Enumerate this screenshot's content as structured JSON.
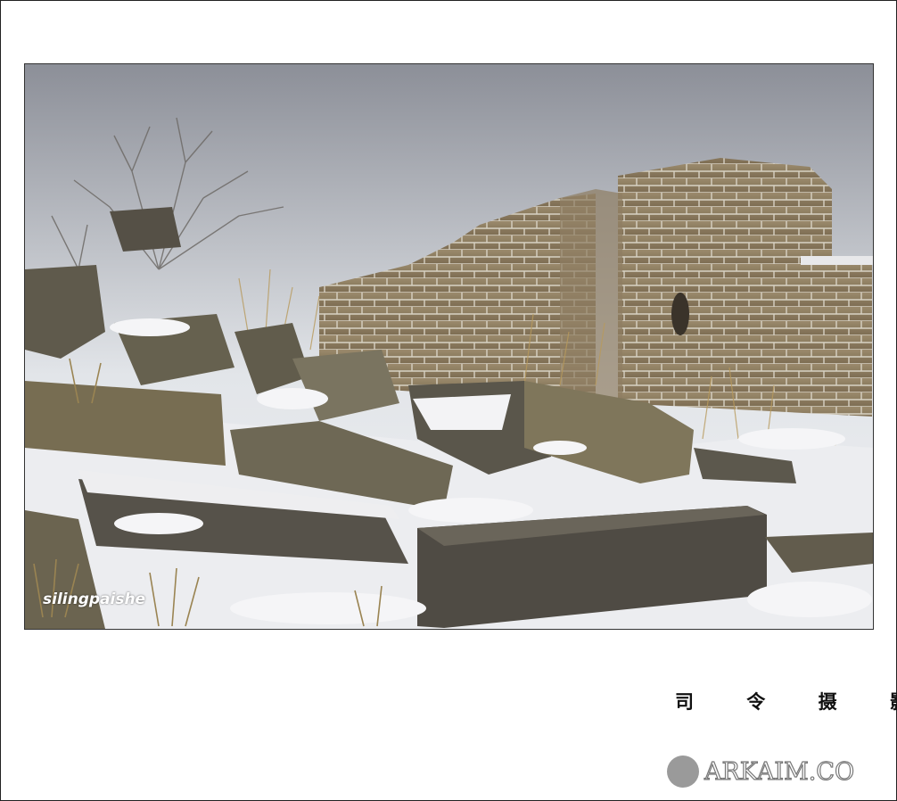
{
  "photo": {
    "subject": "ruined stone wall with snow and rubble",
    "watermark": "silingpaishe"
  },
  "caption": "司 令 摄 影",
  "brand": {
    "text": "ARKAIM.CO"
  },
  "colors": {
    "sky_top": "#8c8f98",
    "sky_bottom": "#eef0f2",
    "brick": "#8a7a5e",
    "stone": "#6b6657",
    "snow": "#f4f4f6"
  }
}
